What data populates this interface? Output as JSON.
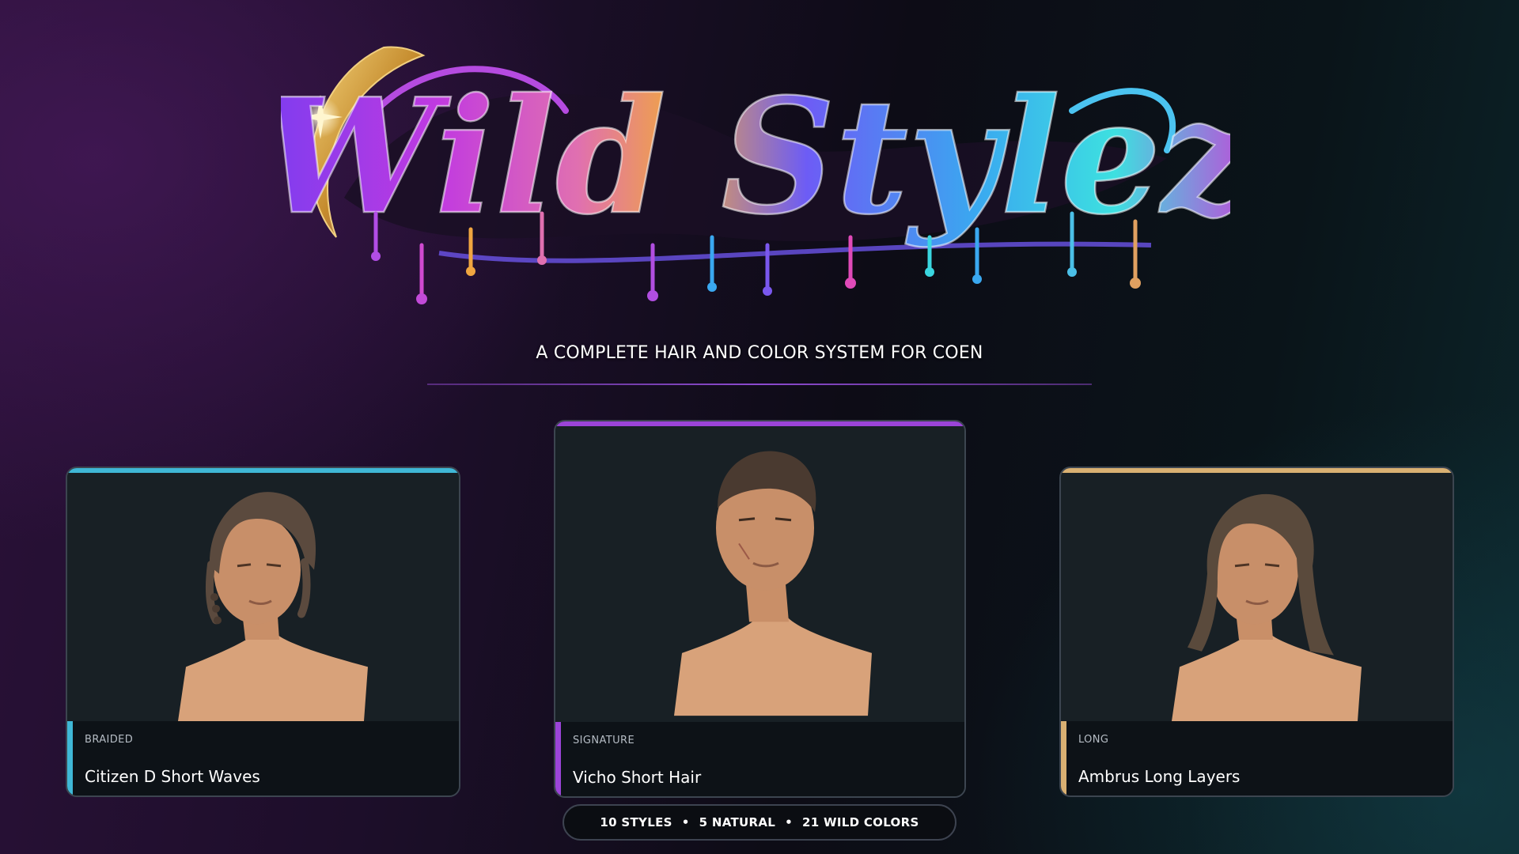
{
  "logo": {
    "text": "Wild Stylez"
  },
  "subtitle": "A COMPLETE HAIR AND COLOR SYSTEM FOR COEN",
  "colors": {
    "accent_purple": "#9b44d8",
    "accent_cyan": "#3fb7d6",
    "accent_gold": "#d9b072",
    "card_bg": "#171d23",
    "card_info_bg": "#0d1217"
  },
  "cards": [
    {
      "tag": "BRAIDED",
      "name": "Citizen D Short Waves",
      "accent_color": "#3fb7d6",
      "hair_style": "short waves with braids",
      "hair_color": "#5b4a3e"
    },
    {
      "tag": "SIGNATURE",
      "name": "Vicho Short Hair",
      "accent_color": "#9b44d8",
      "hair_style": "short cropped",
      "hair_color": "#4a3a30"
    },
    {
      "tag": "LONG",
      "name": "Ambrus Long Layers",
      "accent_color": "#d9b072",
      "hair_style": "long layers",
      "hair_color": "#5a4a3c"
    }
  ],
  "stats": {
    "styles": "10 STYLES",
    "natural": "5 NATURAL",
    "wild": "21 WILD COLORS",
    "separator": "•"
  }
}
